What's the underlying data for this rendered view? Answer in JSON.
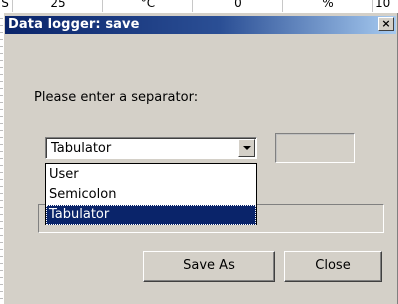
{
  "background_sheet": {
    "cells": [
      "S",
      "25",
      "°C",
      "0",
      "%",
      "10"
    ]
  },
  "dialog": {
    "title": "Data logger: save",
    "close_glyph": "×",
    "prompt": "Please enter a separator:",
    "separator_combo": {
      "selected": "Tabulator",
      "options": [
        "User",
        "Semicolon",
        "Tabulator"
      ],
      "highlighted_index": 2
    },
    "custom_separator_value": "",
    "save_as_label": "Save As",
    "close_label": "Close"
  },
  "colors": {
    "face": "#d4d0c8",
    "title_start": "#0a246a",
    "title_end": "#a6caf0",
    "selection": "#0a246a"
  },
  "icons": [
    "close-icon",
    "chevron-down-icon"
  ]
}
